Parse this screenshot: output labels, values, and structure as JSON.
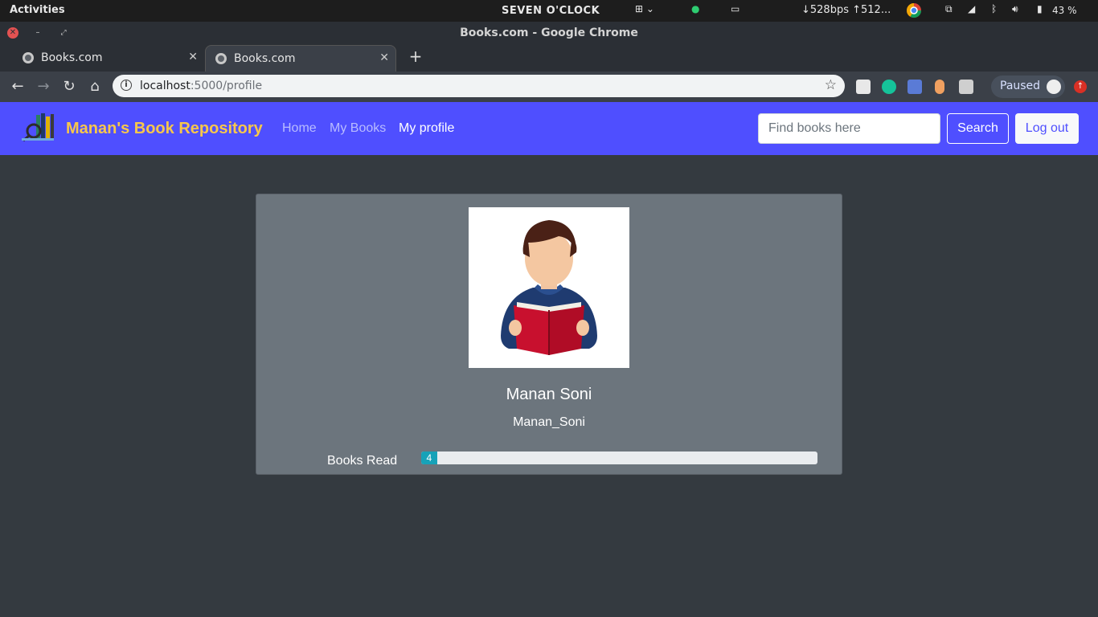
{
  "os_bar": {
    "activities": "Activities",
    "clock": "SEVEN O'CLOCK",
    "network_speed": "↓528bps ↑512...",
    "battery": "43 %"
  },
  "window": {
    "title": "Books.com - Google Chrome"
  },
  "tabs": [
    {
      "label": "Books.com",
      "active": false
    },
    {
      "label": "Books.com",
      "active": true
    }
  ],
  "address_bar": {
    "host": "localhost",
    "path": ":5000/profile"
  },
  "profile_chip": {
    "label": "Paused"
  },
  "site": {
    "brand": "Manan's Book Repository",
    "nav": [
      {
        "label": "Home",
        "active": false
      },
      {
        "label": "My Books",
        "active": false
      },
      {
        "label": "My profile",
        "active": true
      }
    ],
    "search_placeholder": "Find books here",
    "search_button": "Search",
    "logout_button": "Log out",
    "colors": {
      "navbar": "#4f4fff",
      "brand": "#f7c74b",
      "card": "#6c757d",
      "progress_fill": "#17a2b8"
    }
  },
  "profile": {
    "name": "Manan Soni",
    "username": "Manan_Soni",
    "books_read_label": "Books Read",
    "books_read_value": "4",
    "books_read_fraction": 0.04
  }
}
